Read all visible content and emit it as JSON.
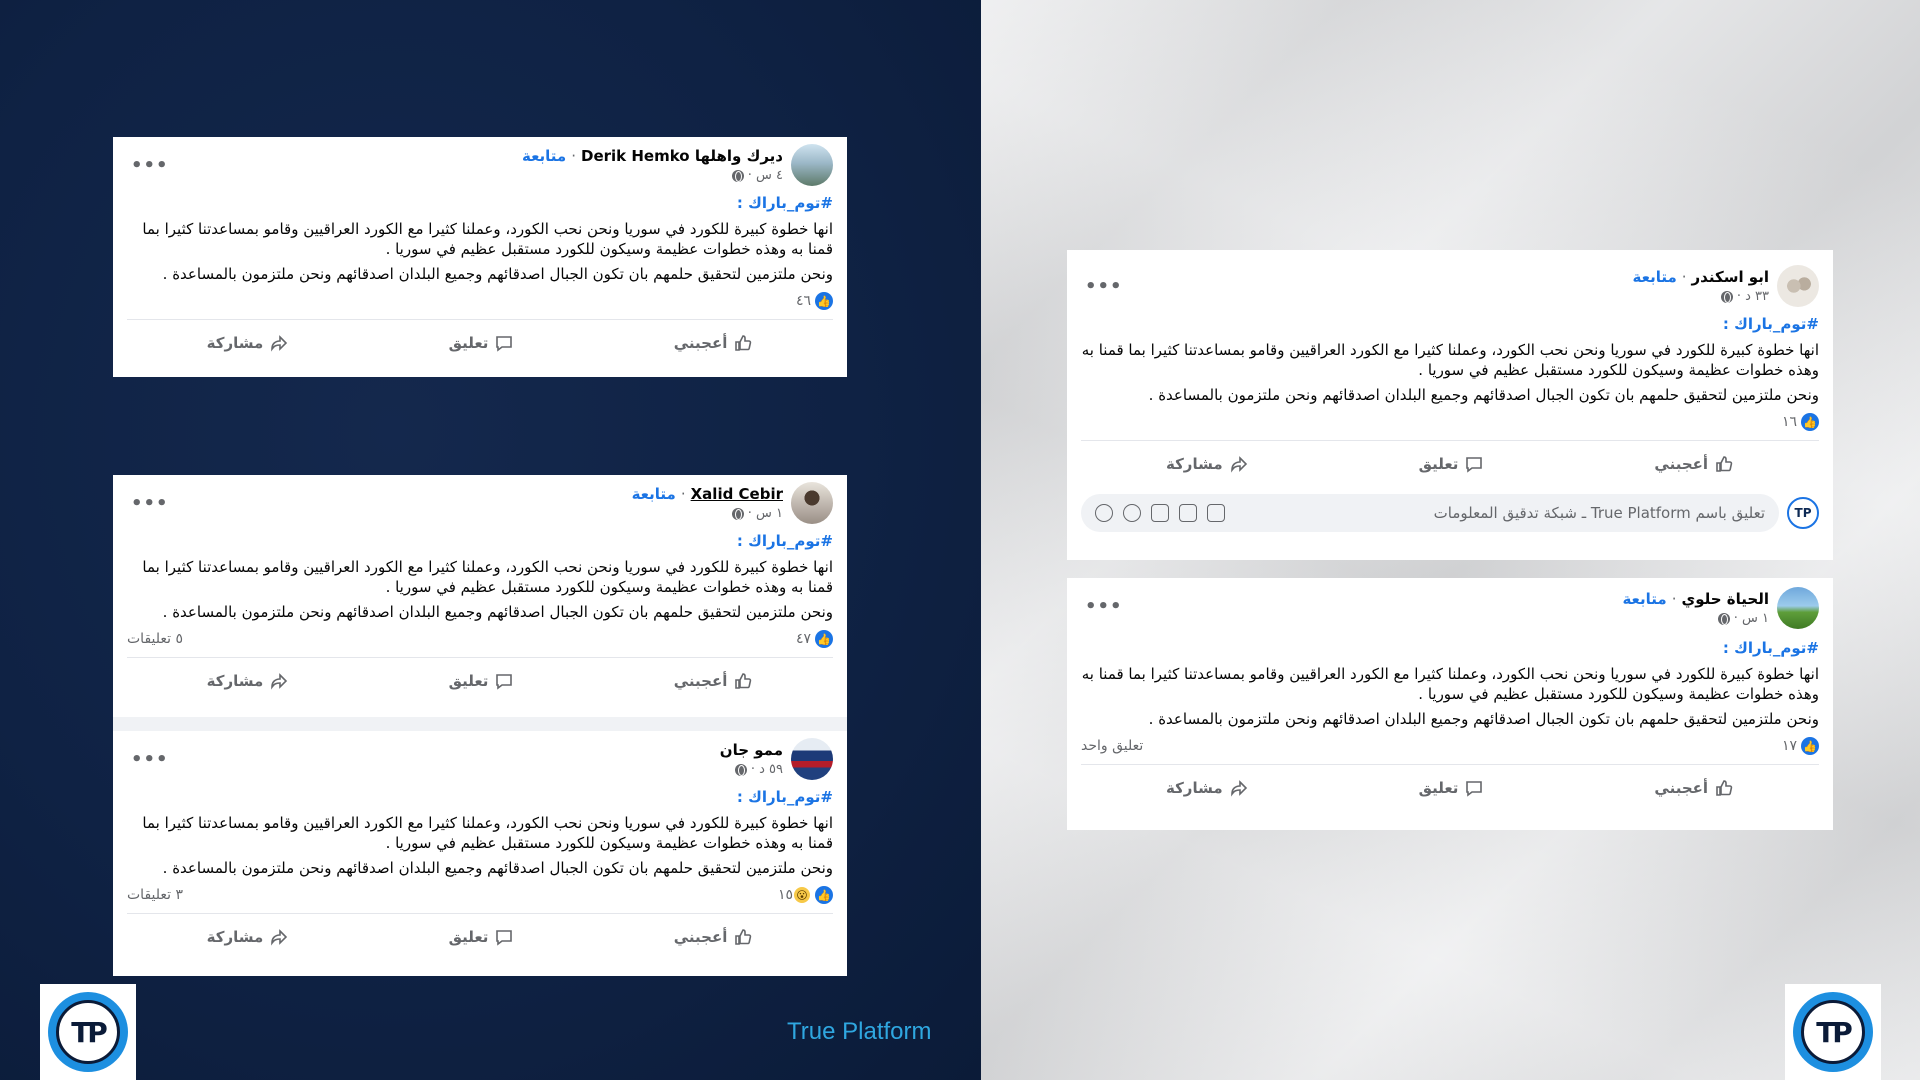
{
  "common": {
    "follow": "متابعة",
    "hashtag": "#توم_باراك :",
    "text_1": "انها خطوة كبيرة للكورد في سوريا ونحن نحب الكورد، وعملنا كثيرا مع الكورد العراقيين وقامو بمساعدتنا كثيرا بما قمنا به وهذه خطوات عظيمة وسيكون للكورد مستقبل عظيم في سوريا .",
    "text_2": "ونحن ملتزمين لتحقيق حلمهم بان تكون الجبال اصدقائهم وجميع البلدان اصدقائهم ونحن ملتزمون بالمساعدة .",
    "like": "أعجبني",
    "comment": "تعليق",
    "share": "مشاركة",
    "more": "•••",
    "like_icon": "👍",
    "wow_icon": "😮"
  },
  "posts": [
    {
      "name": "ديرك واهلها Derik Hemko",
      "time": "٤ س ·",
      "likes": "٤٦",
      "comments": ""
    },
    {
      "name": "Xalid Cebir",
      "time": "١ س ·",
      "likes": "٤٧",
      "comments": "٥ تعليقات"
    },
    {
      "name": "ممو جان",
      "time": "٥٩ د ·",
      "likes": "١٥",
      "comments": "٣ تعليقات"
    },
    {
      "name": "ابو اسكندر",
      "time": "٣٣ د ·",
      "likes": "١٦",
      "comments": ""
    },
    {
      "name": "الحياة حلوي",
      "time": "١ س ·",
      "likes": "١٧",
      "comments": "تعليق واحد"
    }
  ],
  "comment_box": {
    "placeholder": "تعليق باسم True Platform ـ شبكة تدقيق المعلومات",
    "avatar": "TP"
  },
  "brand": {
    "text": "True Platform",
    "logo": "TP",
    "accent": "#1d8fe0"
  }
}
